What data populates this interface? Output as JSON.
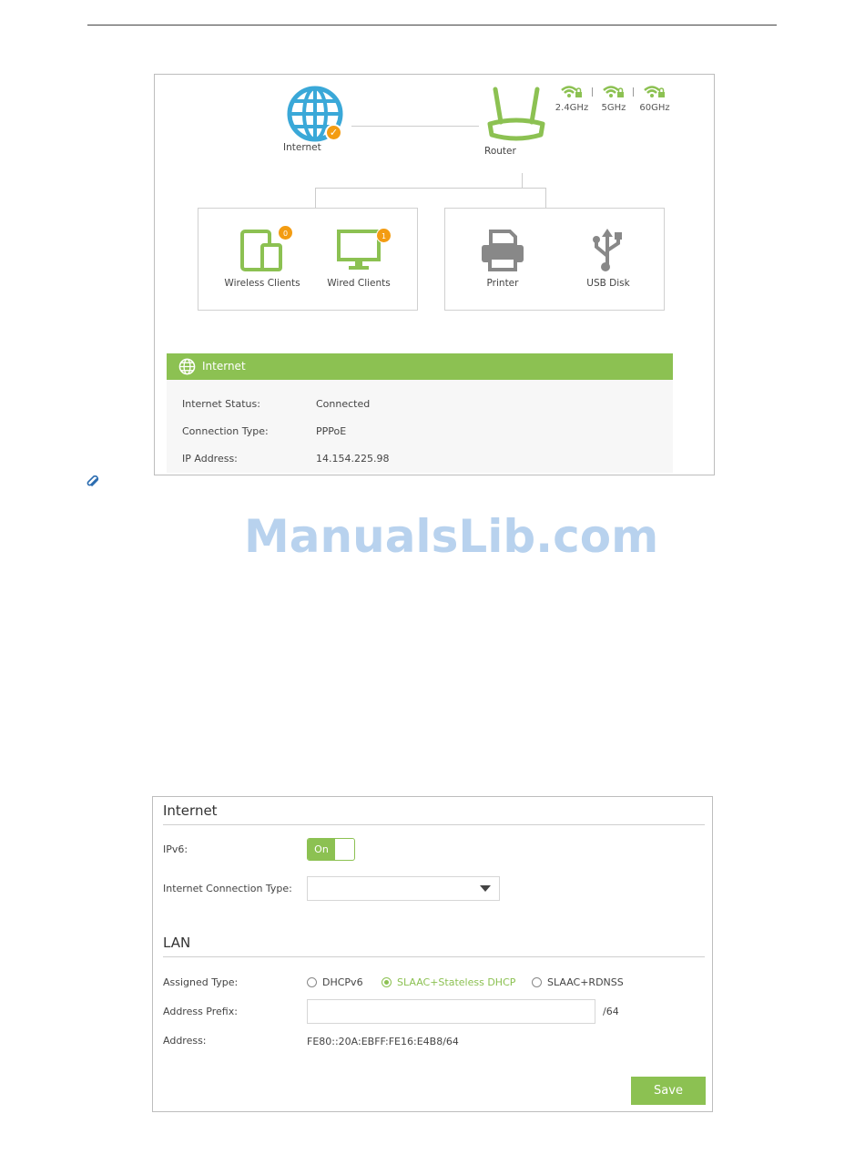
{
  "network_map": {
    "internet_label": "Internet",
    "router_label": "Router",
    "bands": [
      "2.4GHz",
      "5GHz",
      "60GHz"
    ],
    "wireless_clients": {
      "label": "Wireless Clients",
      "count": "0"
    },
    "wired_clients": {
      "label": "Wired Clients",
      "count": "1"
    },
    "printer_label": "Printer",
    "usb_label": "USB Disk",
    "colors": {
      "accent": "#8cc152",
      "badge": "#f39c12",
      "globe": "#3aa8d8",
      "device_gray": "#888888"
    }
  },
  "internet_panel": {
    "title": "Internet",
    "rows": [
      {
        "label": "Internet Status:",
        "value": "Connected"
      },
      {
        "label": "Connection Type:",
        "value": "PPPoE"
      },
      {
        "label": "IP Address:",
        "value": "14.154.225.98"
      }
    ]
  },
  "watermark": "ManualsLib.com",
  "settings": {
    "internet_title": "Internet",
    "ipv6_label": "IPv6:",
    "ipv6_toggle": "On",
    "connection_type_label": "Internet Connection Type:",
    "connection_type_value": "",
    "lan_title": "LAN",
    "assigned_type_label": "Assigned Type:",
    "assigned_options": [
      {
        "label": "DHCPv6",
        "selected": false
      },
      {
        "label": "SLAAC+Stateless DHCP",
        "selected": true
      },
      {
        "label": "SLAAC+RDNSS",
        "selected": false
      }
    ],
    "address_prefix_label": "Address Prefix:",
    "address_prefix_value": "",
    "address_prefix_suffix": "/64",
    "address_label": "Address:",
    "address_value": "FE80::20A:EBFF:FE16:E4B8/64",
    "save_label": "Save"
  }
}
